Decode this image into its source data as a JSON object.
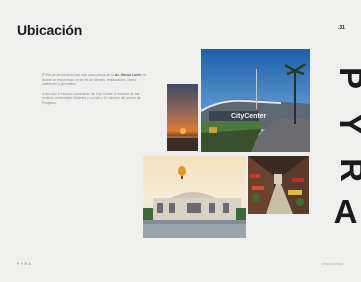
{
  "header": {
    "title": "Ubicación",
    "page_number": ".31"
  },
  "body": {
    "paragraph1_pre": "PYRA se encuentra a tan solo unos pasos de la ",
    "paragraph1_bold": "Av. García Lavín",
    "paragraph1_post": " en donde se encuentran un sin fin de tiendas, restaurantes, bares, cafeterías y gimnasios.",
    "paragraph2": "A tan solo 5 minutos caminando de City Center, 5 minutos de los centros comerciales Altabrisa y La Isla y 10 minutos del puerto de Progreso."
  },
  "photos": {
    "sunset": "sunset-photo",
    "city_center": "city-center-photo",
    "balloon": "balloon-plaza-photo",
    "restaurants": "restaurant-street-photo"
  },
  "brand": {
    "letters": [
      "P",
      "Y",
      "R",
      "A"
    ]
  },
  "footer": {
    "left": "PYRA",
    "right": "PYRA.MX/2019"
  },
  "colors": {
    "background": "#efefee",
    "text": "#1c1c1c",
    "muted": "#8c8c8c"
  }
}
